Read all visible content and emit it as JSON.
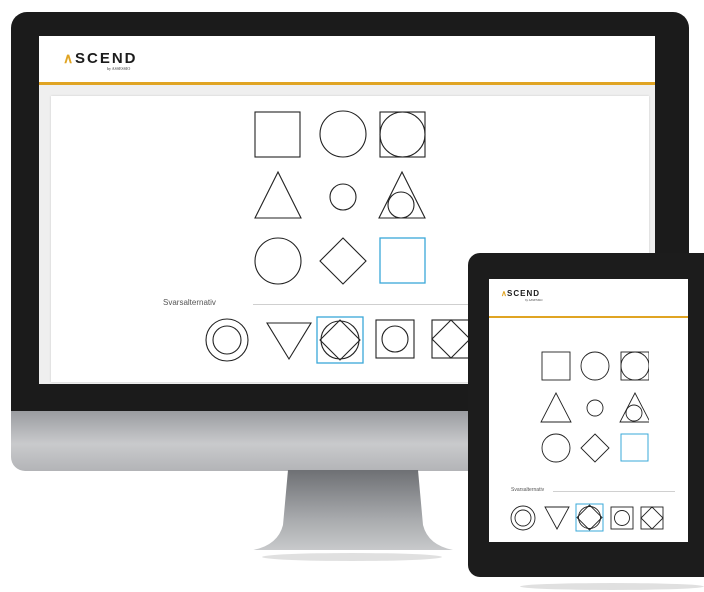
{
  "brand": {
    "logo_text": "SCEND",
    "logo_mark": "^",
    "logo_sub": "by ASSESSIO",
    "accent_color": "#E0A423",
    "selection_color": "#3AA8D8"
  },
  "puzzle": {
    "answer_section_label": "Svarsalternativ",
    "matrix": [
      [
        "square",
        "circle",
        "square-with-circle"
      ],
      [
        "triangle",
        "small-circle",
        "triangle-with-circle"
      ],
      [
        "circle",
        "diamond",
        "empty-selected-cell"
      ]
    ],
    "answer_options": [
      {
        "shape": "double-circle",
        "selected": false
      },
      {
        "shape": "inverted-triangle",
        "selected": false
      },
      {
        "shape": "circle-with-diamond",
        "selected": true
      },
      {
        "shape": "square-with-circle",
        "selected": false
      },
      {
        "shape": "square-with-diamond",
        "selected": false
      }
    ]
  },
  "devices": {
    "desktop": "imac-monitor",
    "tablet": "tablet-device"
  }
}
